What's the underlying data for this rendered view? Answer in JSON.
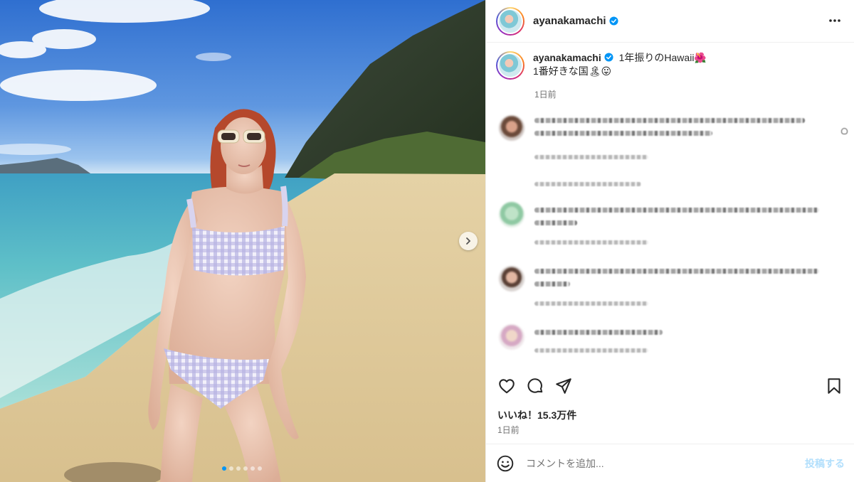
{
  "post": {
    "username": "ayanakamachi",
    "verified": true,
    "avatar_icon": "profile-avatar",
    "caption_line1": "1年振りのHawaii🌺",
    "caption_line2": "1番好きな国🏝😛",
    "caption_time": "1日前",
    "likes": "いいね！15.3万件",
    "post_time": "1日前"
  },
  "carousel": {
    "count": 6,
    "active_index": 0
  },
  "comments": [
    {
      "blurred": true,
      "lines": 2
    },
    {
      "blurred": true,
      "lines": 2
    },
    {
      "blurred": true,
      "lines": 2
    },
    {
      "blurred": true,
      "lines": 1
    }
  ],
  "comment_box": {
    "placeholder": "コメントを追加...",
    "post_label": "投稿する"
  },
  "icons": {
    "more": "more-horizontal-icon",
    "like": "heart-icon",
    "comment": "comment-icon",
    "share": "share-icon",
    "save": "bookmark-icon",
    "emoji": "emoji-icon",
    "next": "chevron-right-icon"
  },
  "colors": {
    "verified_blue": "#0095f6",
    "text": "#262626",
    "secondary": "#737373",
    "post_button_disabled": "#b2dffc"
  }
}
